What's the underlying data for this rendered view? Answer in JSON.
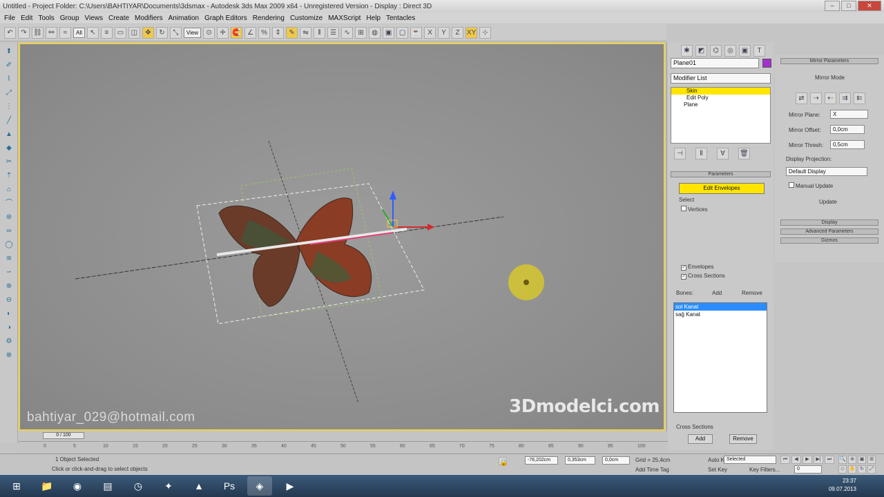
{
  "window": {
    "title": "Untitled    - Project Folder: C:\\Users\\BAHTIYAR\\Documents\\3dsmax    - Autodesk 3ds Max  2009 x64    - Unregistered Version    - Display : Direct 3D",
    "buttons": [
      "–",
      "□",
      "✕"
    ]
  },
  "menu": [
    "File",
    "Edit",
    "Tools",
    "Group",
    "Views",
    "Create",
    "Modifiers",
    "Animation",
    "Graph Editors",
    "Rendering",
    "Customize",
    "MAXScript",
    "Help",
    "Tentacles"
  ],
  "toolbar": {
    "selection_filter": "All",
    "ref_coord": "View"
  },
  "viewport": {
    "watermark_email": "bahtiyar_029@hotmail.com",
    "watermark_logo": "3Dmodelci.com"
  },
  "command_panel": {
    "object_name": "Plane01",
    "object_color": "#a52fd1",
    "modifier_list_label": "Modifier List",
    "stack": [
      {
        "label": "Skin",
        "selected": true
      },
      {
        "label": "Edit Poly",
        "selected": false
      },
      {
        "label": "Plane",
        "selected": false
      }
    ],
    "parameters_header": "Parameters",
    "edit_envelopes_button": "Edit Envelopes",
    "select_label": "Select",
    "vertices_label": "Vertices",
    "envelopes_label": "Envelopes",
    "cross_sections_label": "Cross Sections",
    "bones_label": "Bones:",
    "add_label": "Add",
    "remove_label": "Remove",
    "bones": [
      {
        "name": "sol Kanat",
        "selected": true
      },
      {
        "name": "sağ Kanat",
        "selected": false
      }
    ],
    "cross_sections_footer": "Cross Sections",
    "bottom_add": "Add",
    "bottom_remove": "Remove"
  },
  "mirror_panel": {
    "header": "Mirror Parameters",
    "mirror_mode_label": "Mirror Mode",
    "mirror_plane_label": "Mirror Plane:",
    "mirror_plane_value": "X",
    "mirror_offset_label": "Mirror Offset:",
    "mirror_offset_value": "0,0cm",
    "mirror_thresh_label": "Mirror Thresh:",
    "mirror_thresh_value": "0,5cm",
    "display_projection_label": "Display Projection:",
    "display_projection_value": "Default Display",
    "manual_update_label": "Manual Update",
    "update_button": "Update",
    "rollouts": [
      "Display",
      "Advanced Parameters",
      "Gizmos"
    ]
  },
  "timeline": {
    "frame_slider": "0 / 100",
    "ticks": [
      "0",
      "5",
      "10",
      "15",
      "20",
      "25",
      "30",
      "35",
      "40",
      "45",
      "50",
      "55",
      "60",
      "65",
      "70",
      "75",
      "80",
      "85",
      "90",
      "95",
      "100"
    ]
  },
  "status": {
    "selected_text": "1 Object Selected",
    "prompt_text": "Click or click-and-drag to select objects",
    "x_value": "-76,202cm",
    "y_value": "0,353cm",
    "z_value": "0,0cm",
    "grid_value": "Grid = 25,4cm",
    "auto_key": "Auto Key",
    "selected_dropdown": "Selected",
    "set_key": "Set Key",
    "key_filters": "Key Filters...",
    "add_time_tag": "Add Time Tag",
    "frame_value": "0"
  },
  "taskbar": {
    "time": "23:37",
    "date": "09.07.2013",
    "apps": [
      "start",
      "explorer",
      "chrome",
      "app",
      "clock-app",
      "tool",
      "pdf",
      "photoshop",
      "3dsmax",
      "video"
    ]
  }
}
